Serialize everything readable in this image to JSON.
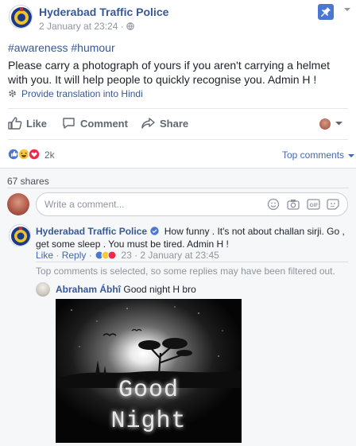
{
  "post": {
    "page_name": "Hyderabad Traffic Police",
    "timestamp": "2 January at 23:24",
    "meta_separator": " · ",
    "hashtags": "#awareness #humour",
    "text": "Please carry a photograph of yours if you aren't carrying a helmet with you. It will help people to quickly recognise you. Admin H !",
    "translate_label": "Provide translation into Hindi",
    "audience_icon": "globe-icon"
  },
  "actions": {
    "like": "Like",
    "comment": "Comment",
    "share": "Share"
  },
  "reactions": {
    "icons": [
      "like-reaction-icon",
      "haha-reaction-icon",
      "love-reaction-icon"
    ],
    "count": "2k",
    "sort_label": "Top comments"
  },
  "shares": "67 shares",
  "composer": {
    "placeholder": "Write a comment...",
    "icons": [
      "emoji-icon",
      "camera-icon",
      "gif-icon",
      "sticker-icon"
    ]
  },
  "comments": [
    {
      "author": "Hyderabad Traffic Police",
      "verified": true,
      "text": "How funny . It's not about challan sirji. Go , get some sleep . You must be tired. Admin H !",
      "like_label": "Like",
      "reply_label": "Reply",
      "reaction_count": "23",
      "timestamp": "2 January at 23:45",
      "filtered_notice": "Top comments is selected, so some replies may have been filtered out.",
      "replies": [
        {
          "author": "Abraham Ábhî",
          "text": "Good night H bro",
          "image_text_line1": "Good",
          "image_text_line2": "Night"
        }
      ]
    }
  ],
  "colors": {
    "link": "#365899",
    "accent": "#4267b2",
    "meta": "#90949c",
    "like_blue": "#4a76d4",
    "love_red": "#f0284a",
    "haha_yellow": "#f7c93e"
  }
}
